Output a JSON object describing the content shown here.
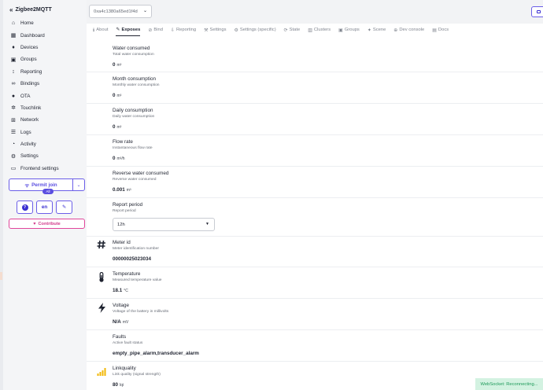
{
  "app": {
    "title": "Zigbee2MQTT",
    "collapse_icon": "chevrons-left-icon"
  },
  "sidebar": {
    "items": [
      {
        "label": "Home",
        "icon": "home-icon",
        "glyph": "⌂"
      },
      {
        "label": "Dashboard",
        "icon": "dashboard-icon",
        "glyph": "▦"
      },
      {
        "label": "Devices",
        "icon": "devices-icon",
        "glyph": "♦"
      },
      {
        "label": "Groups",
        "icon": "groups-icon",
        "glyph": "▣"
      },
      {
        "label": "Reporting",
        "icon": "reporting-icon",
        "glyph": "↕"
      },
      {
        "label": "Bindings",
        "icon": "bindings-icon",
        "glyph": "∞"
      },
      {
        "label": "OTA",
        "icon": "ota-icon",
        "glyph": "●"
      },
      {
        "label": "Touchlink",
        "icon": "touchlink-icon",
        "glyph": "✲"
      },
      {
        "label": "Network",
        "icon": "network-icon",
        "glyph": "⊞"
      },
      {
        "label": "Logs",
        "icon": "logs-icon",
        "glyph": "☰"
      },
      {
        "label": "Activity",
        "icon": "activity-icon",
        "glyph": "◔"
      },
      {
        "label": "Settings",
        "icon": "settings-icon",
        "glyph": "⚙"
      },
      {
        "label": "Frontend settings",
        "icon": "frontend-settings-icon",
        "glyph": "▭"
      }
    ],
    "permit_join": {
      "label": "Permit join",
      "badge": "All",
      "icon": "antenna-icon",
      "dropdown_icon": "chevron-down-icon"
    },
    "buttons": {
      "help_glyph": "?",
      "language": "en",
      "theme_glyph": "✎"
    },
    "contribute": {
      "label": "Contribute",
      "icon": "heart-icon"
    }
  },
  "header": {
    "device_select": "0xa4c1380a65ed1f4d",
    "device_select_arrow": "⌄"
  },
  "tabs": [
    {
      "label": "About",
      "glyph": "ℹ",
      "active": false
    },
    {
      "label": "Exposes",
      "glyph": "✎",
      "active": true
    },
    {
      "label": "Bind",
      "glyph": "⊘",
      "active": false
    },
    {
      "label": "Reporting",
      "glyph": "⇩",
      "active": false
    },
    {
      "label": "Settings",
      "glyph": "⚒",
      "active": false
    },
    {
      "label": "Settings (specific)",
      "glyph": "⚙",
      "active": false
    },
    {
      "label": "State",
      "glyph": "⟳",
      "active": false
    },
    {
      "label": "Clusters",
      "glyph": "▥",
      "active": false
    },
    {
      "label": "Groups",
      "glyph": "▣",
      "active": false
    },
    {
      "label": "Scene",
      "glyph": "✦",
      "active": false
    },
    {
      "label": "Dev console",
      "glyph": "⊕",
      "active": false
    },
    {
      "label": "Docs",
      "glyph": "▤",
      "active": false
    }
  ],
  "exposes": [
    {
      "title": "Water consumed",
      "desc": "Total water consumption",
      "value": "0",
      "unit": "m³",
      "icon": ""
    },
    {
      "title": "Month consumption",
      "desc": "Monthly water consumption",
      "value": "0",
      "unit": "m³",
      "icon": ""
    },
    {
      "title": "Daily consumption",
      "desc": "Daily water consumption",
      "value": "0",
      "unit": "m³",
      "icon": ""
    },
    {
      "title": "Flow rate",
      "desc": "Instantaneous flow rate",
      "value": "0",
      "unit": "m³/h",
      "icon": ""
    },
    {
      "title": "Reverse water consumed",
      "desc": "Reverse water consumed",
      "value": "0.001",
      "unit": "m³",
      "icon": ""
    },
    {
      "title": "Report period",
      "desc": "Report period",
      "select": "12h",
      "icon": ""
    },
    {
      "title": "Meter id",
      "desc": "Meter identification number",
      "value": "00000025023034",
      "unit": "",
      "icon": "hash-icon"
    },
    {
      "title": "Temperature",
      "desc": "Measured temperature value",
      "value": "18.1",
      "unit": "°C",
      "icon": "thermometer-icon"
    },
    {
      "title": "Voltage",
      "desc": "Voltage of the battery in millivolts",
      "value": "N/A",
      "unit": "mV",
      "icon": "bolt-icon"
    },
    {
      "title": "Faults",
      "desc": "Active fault status",
      "value": "empty_pipe_alarm,transducer_alarm",
      "unit": "",
      "icon": ""
    },
    {
      "title": "Linkquality",
      "desc": "Link quality (signal strength)",
      "value": "80",
      "unit": "lqi",
      "icon": "signal-icon"
    }
  ],
  "status": {
    "websocket": "WebSocket: Reconnecting..."
  },
  "colors": {
    "accent": "#5a4ee0",
    "pink": "#d23b8c",
    "status_bg": "#d3f2e1",
    "status_text": "#1e9a5a",
    "signal": "#f2b705"
  }
}
